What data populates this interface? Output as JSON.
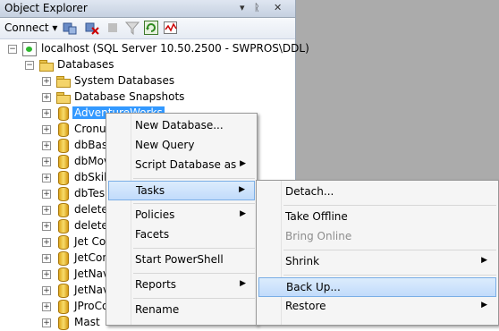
{
  "panel": {
    "title": "Object Explorer",
    "pin": "→ И ×",
    "connect_label": "Connect ▾"
  },
  "tree": {
    "server": "localhost (SQL Server 10.50.2500 - SWPROS\\DDL)",
    "databases": "Databases",
    "system_databases": "System Databases",
    "snapshots": "Database Snapshots",
    "items": [
      "AdventureWorks",
      "Cronus",
      "dbBas",
      "dbMov",
      "dbSkil",
      "dbTes",
      "delete",
      "delete",
      "Jet Co",
      "JetCon",
      "JetNav",
      "JetNav",
      "JProCo",
      "Mast"
    ]
  },
  "context_menu": {
    "items": [
      {
        "label": "New Database..."
      },
      {
        "label": "New Query"
      },
      {
        "label": "Script Database as",
        "submenu": true
      },
      {
        "label": "Tasks",
        "submenu": true,
        "highlight": true
      },
      {
        "label": "Policies",
        "submenu": true
      },
      {
        "label": "Facets"
      },
      {
        "label": "Start PowerShell"
      },
      {
        "label": "Reports",
        "submenu": true
      },
      {
        "label": "Rename"
      }
    ]
  },
  "tasks_menu": {
    "items": [
      {
        "label": "Detach..."
      },
      {
        "label": "Take Offline"
      },
      {
        "label": "Bring Online",
        "disabled": true
      },
      {
        "label": "Shrink",
        "submenu": true
      },
      {
        "label": "Back Up...",
        "highlight": true
      },
      {
        "label": "Restore",
        "submenu": true
      }
    ]
  },
  "colors": {
    "selection": "#3399ff",
    "menu_highlight": "#c1dbfb",
    "folder": "#f4d46a",
    "database": "#f7dc6b"
  }
}
